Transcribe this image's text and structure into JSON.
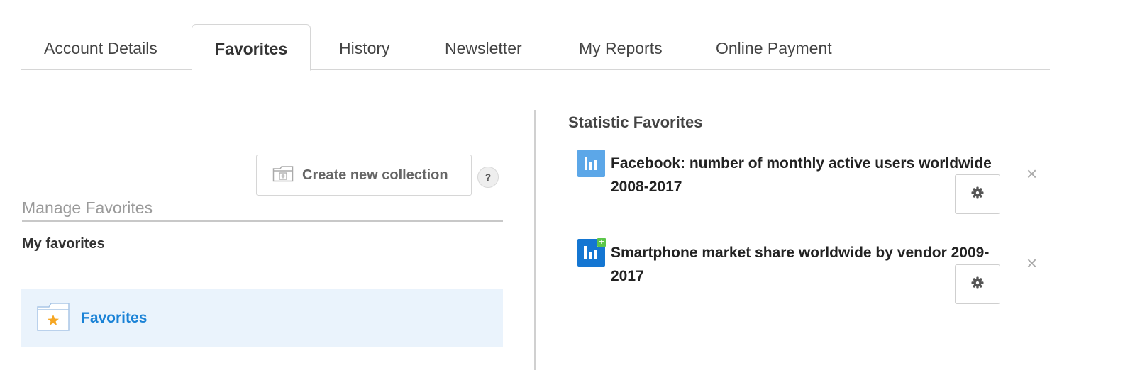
{
  "tabs": [
    {
      "label": "Account Details"
    },
    {
      "label": "Favorites"
    },
    {
      "label": "History"
    },
    {
      "label": "Newsletter"
    },
    {
      "label": "My Reports"
    },
    {
      "label": "Online Payment"
    }
  ],
  "active_tab": "Favorites",
  "left_panel": {
    "create_collection_label": "Create new collection",
    "help_label": "?",
    "manage_label": "Manage Favorites",
    "my_favorites_label": "My favorites",
    "collections": [
      {
        "label": "Favorites",
        "icon": "folder-star-icon"
      }
    ]
  },
  "right_panel": {
    "title": "Statistic Favorites",
    "items": [
      {
        "title": "Facebook: number of monthly active users worldwide 2008-2017",
        "icon": "bar-chart-icon",
        "premium": false
      },
      {
        "title": "Smartphone market share worldwide by vendor 2009-2017",
        "icon": "bar-chart-plus-icon",
        "premium": true
      }
    ],
    "close_symbol": "×"
  },
  "colors": {
    "accent": "#1a82d6",
    "highlight_bg": "#eaf3fc",
    "icon_light": "#5ca7e8",
    "icon_dark": "#1476d2",
    "premium_badge": "#5cc64a",
    "star": "#f5a623"
  }
}
